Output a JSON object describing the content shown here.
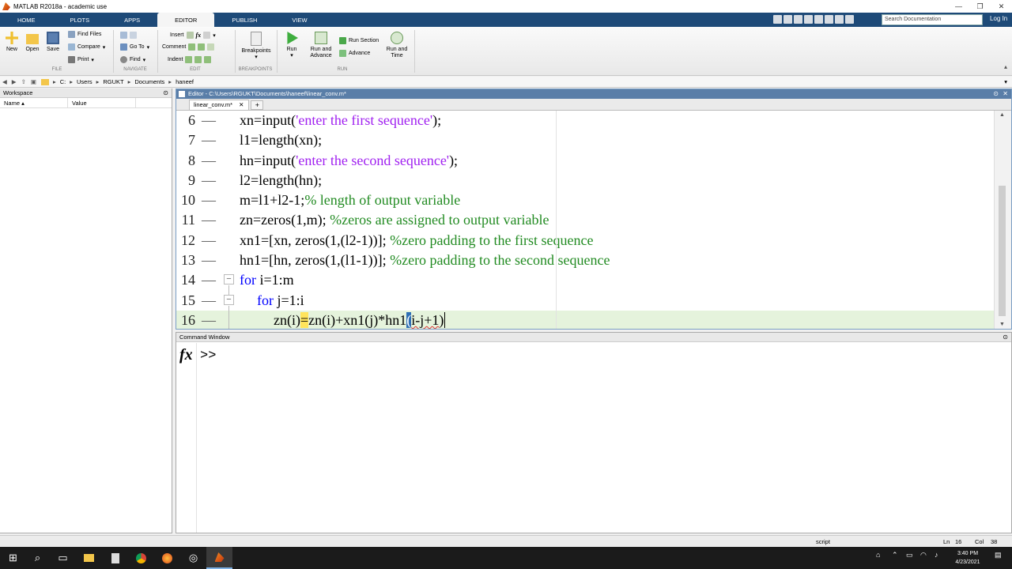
{
  "window": {
    "title": "MATLAB R2018a - academic use",
    "controls": [
      "—",
      "❐",
      "✕"
    ]
  },
  "ribbon_tabs": [
    "HOME",
    "PLOTS",
    "APPS",
    "EDITOR",
    "PUBLISH",
    "VIEW"
  ],
  "active_tab": "EDITOR",
  "search": {
    "placeholder": "Search Documentation"
  },
  "login_label": "Log In",
  "ribbon": {
    "file": {
      "new": "New",
      "open": "Open",
      "save": "Save",
      "find_files": "Find Files",
      "compare": "Compare",
      "print": "Print",
      "group": "FILE"
    },
    "navigate": {
      "go_to": "Go To",
      "find": "Find",
      "group": "NAVIGATE"
    },
    "edit": {
      "insert": "Insert",
      "comment": "Comment",
      "indent": "Indent",
      "fx": "fx",
      "group": "EDIT"
    },
    "breakpoints": {
      "label": "Breakpoints",
      "group": "BREAKPOINTS"
    },
    "run": {
      "run": "Run",
      "run_and_advance_1": "Run and",
      "run_and_advance_2": "Advance",
      "run_section": "Run Section",
      "advance": "Advance",
      "run_and_time_1": "Run and",
      "run_and_time_2": "Time",
      "group": "RUN"
    }
  },
  "address": {
    "path": [
      "C:",
      "Users",
      "RGUKT",
      "Documents",
      "haneef"
    ]
  },
  "workspace": {
    "title": "Workspace",
    "col_name": "Name ▴",
    "col_value": "Value"
  },
  "editor": {
    "title": "Editor - C:\\Users\\RGUKT\\Documents\\haneef\\linear_conv.m*",
    "tab": "linear_conv.m*",
    "tab_close": "✕",
    "add_tab": "+",
    "lines": [
      {
        "num": "6",
        "parts": [
          [
            "",
            "xn=input("
          ],
          [
            "str",
            "'enter the first sequence'"
          ],
          [
            "",
            ");"
          ]
        ]
      },
      {
        "num": "7",
        "parts": [
          [
            "",
            "l1=length(xn);"
          ]
        ]
      },
      {
        "num": "8",
        "parts": [
          [
            "",
            "hn=input("
          ],
          [
            "str",
            "'enter the second sequence'"
          ],
          [
            "",
            ");"
          ]
        ]
      },
      {
        "num": "9",
        "parts": [
          [
            "",
            "l2=length(hn);"
          ]
        ]
      },
      {
        "num": "10",
        "parts": [
          [
            "",
            "m=l1+l2-1;"
          ],
          [
            "cmt",
            "% length of output variable"
          ]
        ]
      },
      {
        "num": "11",
        "parts": [
          [
            "",
            "zn=zeros(1,m); "
          ],
          [
            "cmt",
            "%zeros are assigned to output variable"
          ]
        ]
      },
      {
        "num": "12",
        "parts": [
          [
            "",
            "xn1=[xn, zeros(1,(l2-1))]; "
          ],
          [
            "cmt",
            "%zero padding to the first sequence"
          ]
        ]
      },
      {
        "num": "13",
        "parts": [
          [
            "",
            "hn1=[hn, zeros(1,(l1-1))]; "
          ],
          [
            "cmt",
            "%zero padding to the second sequence"
          ]
        ]
      },
      {
        "num": "14",
        "parts": [
          [
            "kw",
            "for"
          ],
          [
            "",
            " i=1:m"
          ]
        ]
      },
      {
        "num": "15",
        "parts": [
          [
            "kw",
            "for"
          ],
          [
            "",
            " j=1:i"
          ]
        ]
      },
      {
        "num": "16",
        "parts": [
          [
            "",
            "zn(i)"
          ],
          [
            "hl",
            "="
          ],
          [
            "",
            "zn(i)+xn1(j)*hn1"
          ],
          [
            "bracket",
            "("
          ],
          [
            "squig",
            "i-j+1"
          ],
          [
            "",
            ")"
          ]
        ]
      }
    ]
  },
  "command_window": {
    "title": "Command Window",
    "fx": "fx",
    "prompt": ">>"
  },
  "status": {
    "mode": "script",
    "ln_label": "Ln",
    "ln": "16",
    "col_label": "Col",
    "col": "38"
  },
  "taskbar": {
    "time": "3:40 PM",
    "date": "4/23/2021"
  },
  "colors": {
    "keyword": "#0000ff",
    "string": "#a020f0",
    "comment": "#228b22",
    "ribbon_blue": "#1e4a78"
  }
}
